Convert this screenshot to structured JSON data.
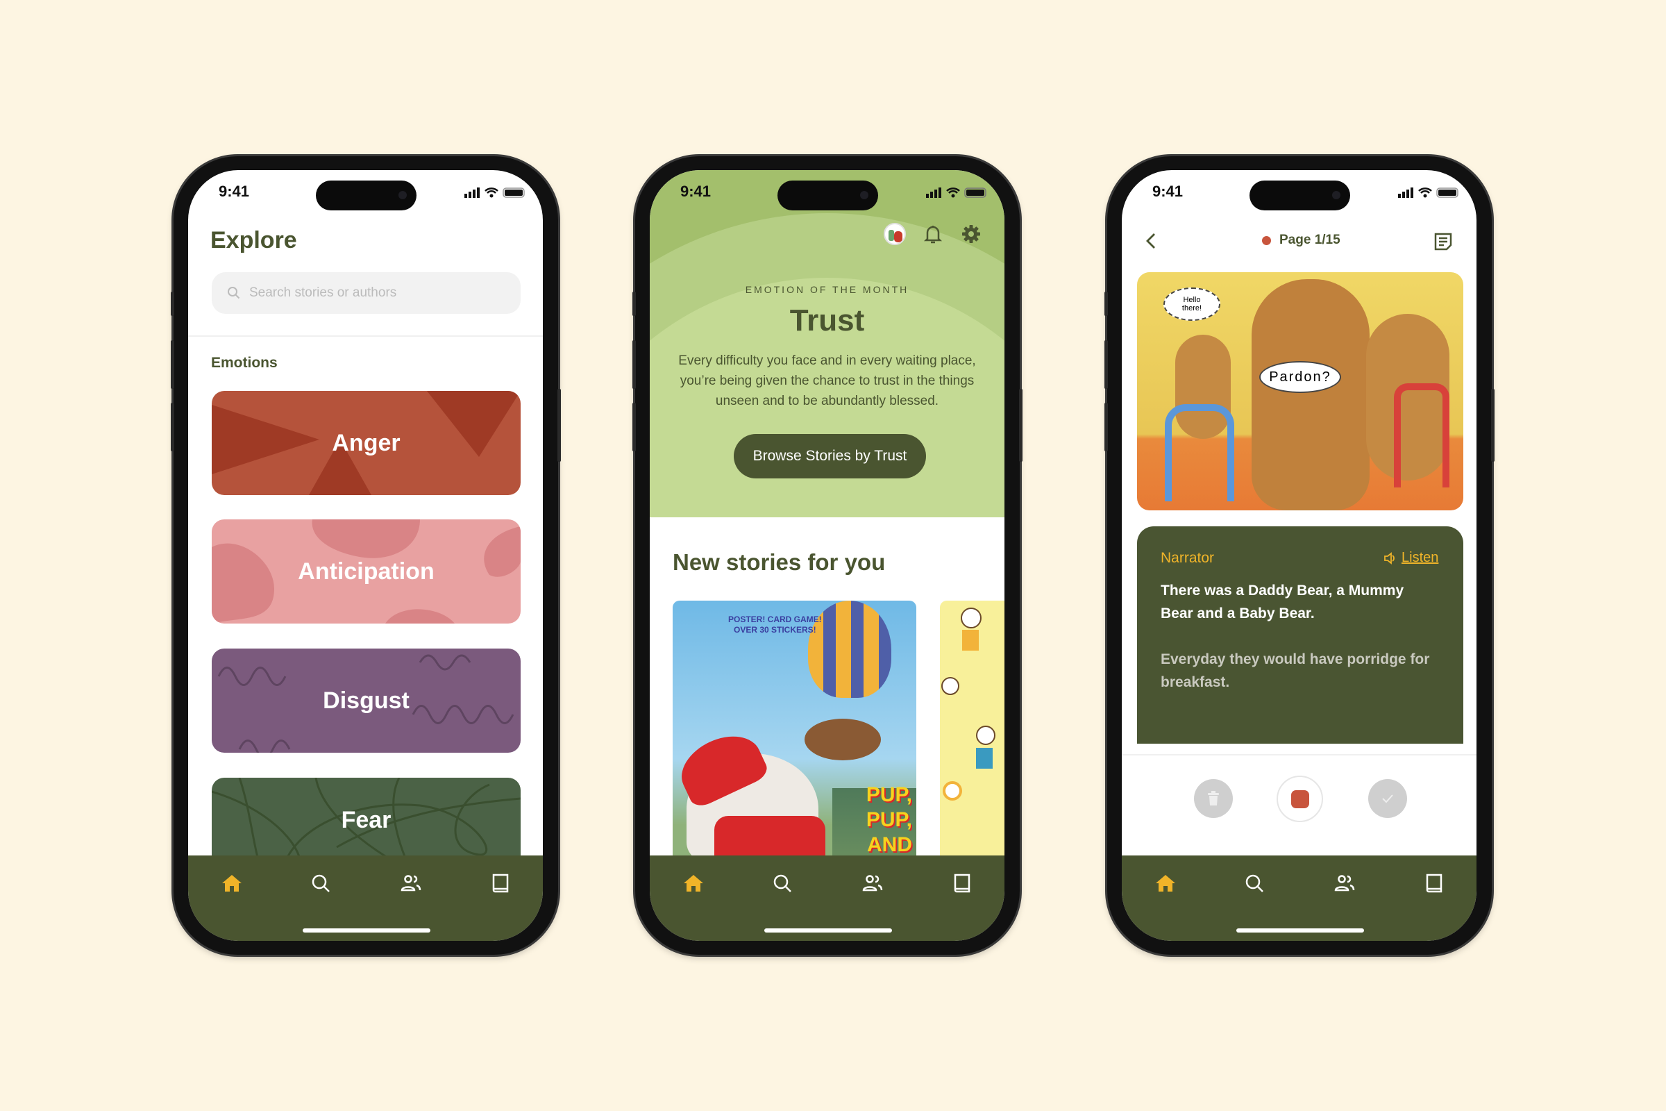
{
  "colors": {
    "background": "#fdf5e2",
    "brand_dark": "#4a5530",
    "accent_yellow": "#f0b429",
    "record_red": "#c8553d"
  },
  "status_bar": {
    "time": "9:41"
  },
  "tab_bar": {
    "items": [
      {
        "icon": "home-icon",
        "active": true
      },
      {
        "icon": "search-icon"
      },
      {
        "icon": "people-icon"
      },
      {
        "icon": "book-icon"
      }
    ]
  },
  "explore": {
    "title": "Explore",
    "search_placeholder": "Search stories or authors",
    "section_title": "Emotions",
    "emotions": [
      {
        "label": "Anger",
        "color": "#b5533b"
      },
      {
        "label": "Anticipation",
        "color": "#e8a1a1"
      },
      {
        "label": "Disgust",
        "color": "#7b5a7d"
      },
      {
        "label": "Fear",
        "color": "#4b6246"
      }
    ]
  },
  "home": {
    "eyebrow": "EMOTION OF THE MONTH",
    "emotion": "Trust",
    "description": "Every difficulty you face and in every waiting place, you’re being given the chance to trust in the things unseen and to be abundantly blessed.",
    "cta": "Browse Stories by Trust",
    "section_title": "New stories for you",
    "books": [
      {
        "cover_text_top": "POSTER! CARD GAME!",
        "cover_text_mid": "OVER 30 STICKERS!",
        "cover_title": "PUP, PUP, AND"
      },
      {}
    ]
  },
  "reader": {
    "page_label": "Page 1/15",
    "illustration": {
      "bubble_1": "Hello there!",
      "bubble_2": "Pardon?"
    },
    "speaker": "Narrator",
    "listen": "Listen",
    "current_text": "There was a Daddy Bear, a Mummy Bear and a Baby Bear.",
    "next_text": "Everyday they would have porridge for breakfast."
  }
}
